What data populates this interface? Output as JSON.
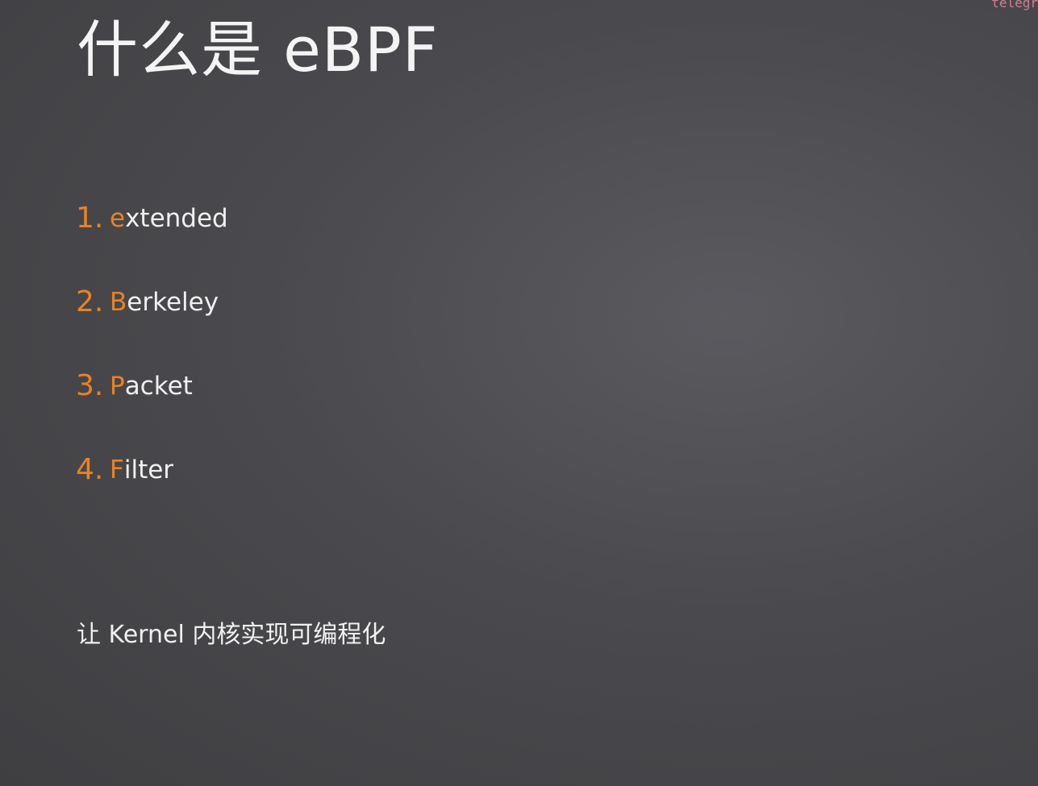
{
  "slide": {
    "title": "什么是 eBPF",
    "items": [
      {
        "number": "1.",
        "first_letter": "e",
        "rest": "xtended"
      },
      {
        "number": "2.",
        "first_letter": "B",
        "rest": "erkeley"
      },
      {
        "number": "3.",
        "first_letter": "P",
        "rest": "acket"
      },
      {
        "number": "4.",
        "first_letter": "F",
        "rest": "ilter"
      }
    ],
    "subtitle": "让 Kernel 内核实现可编程化",
    "watermark": "telegr"
  },
  "colors": {
    "accent": "#e98225",
    "text": "#f0f0f0",
    "background": "#4a4a4e"
  }
}
